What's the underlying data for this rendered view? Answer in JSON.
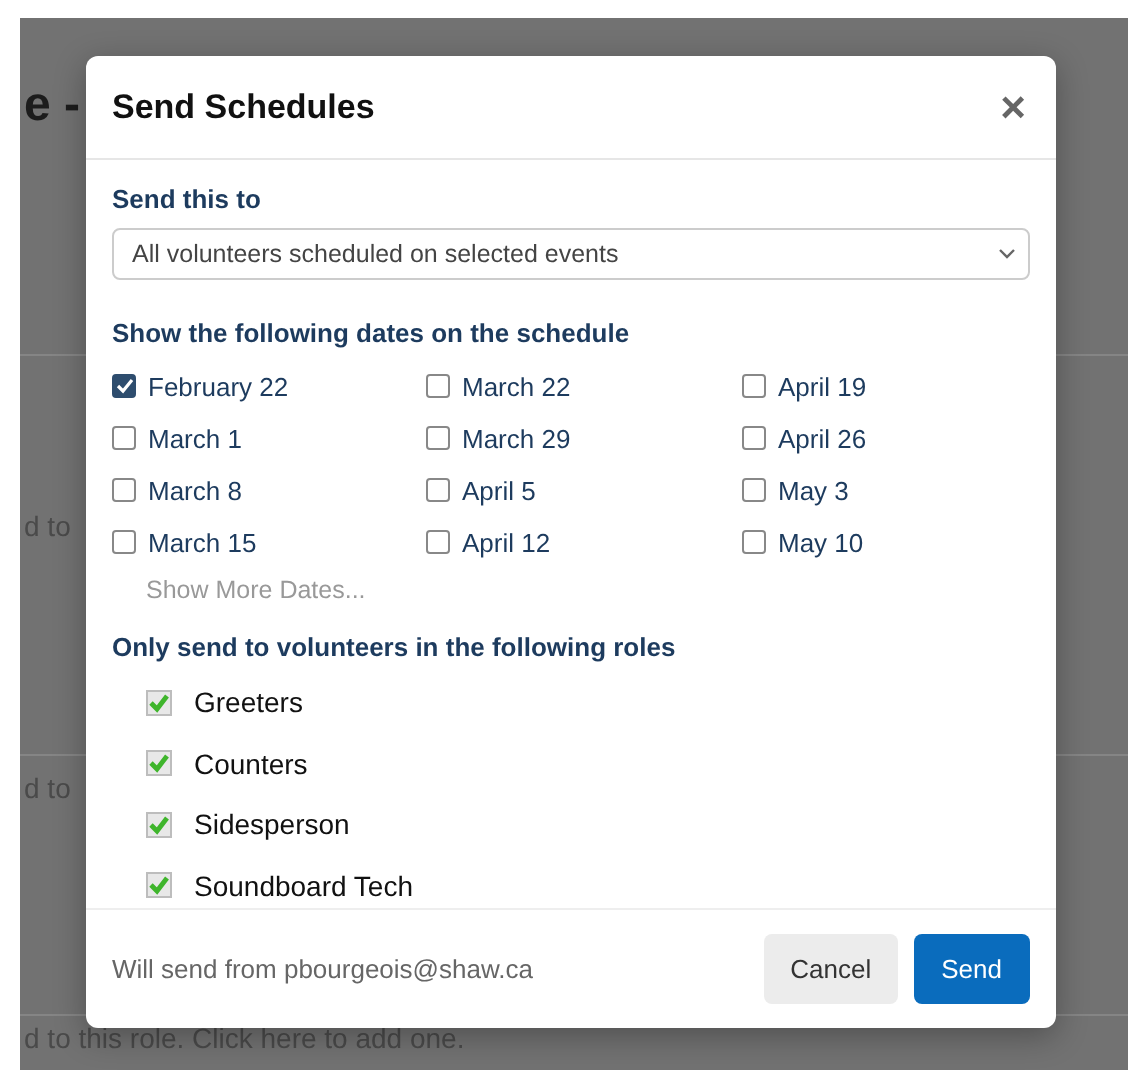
{
  "background": {
    "heading": "e -",
    "rows": [
      "d to",
      "d to",
      "d to this role. Click here to add one."
    ]
  },
  "dialog": {
    "title": "Send Schedules",
    "close": "×",
    "recipients": {
      "label": "Send this to",
      "value": "All volunteers scheduled on selected events"
    },
    "dates": {
      "label": "Show the following dates on the schedule",
      "items": [
        {
          "label": "February 22",
          "checked": true
        },
        {
          "label": "March 22",
          "checked": false
        },
        {
          "label": "April 19",
          "checked": false
        },
        {
          "label": "March 1",
          "checked": false
        },
        {
          "label": "March 29",
          "checked": false
        },
        {
          "label": "April 26",
          "checked": false
        },
        {
          "label": "March 8",
          "checked": false
        },
        {
          "label": "April 5",
          "checked": false
        },
        {
          "label": "May 3",
          "checked": false
        },
        {
          "label": "March 15",
          "checked": false
        },
        {
          "label": "April 12",
          "checked": false
        },
        {
          "label": "May 10",
          "checked": false
        }
      ],
      "more": "Show More Dates..."
    },
    "roles": {
      "label": "Only send to volunteers in the following roles",
      "items": [
        {
          "label": "Greeters",
          "checked": true
        },
        {
          "label": "Counters",
          "checked": true
        },
        {
          "label": "Sidesperson",
          "checked": true
        },
        {
          "label": "Soundboard Tech",
          "checked": true
        }
      ]
    },
    "footer": {
      "sender": "Will send from pbourgeois@shaw.ca",
      "buttons": [
        {
          "label": "Cancel",
          "kind": "secondary"
        },
        {
          "label": "Send",
          "kind": "primary"
        }
      ]
    }
  }
}
